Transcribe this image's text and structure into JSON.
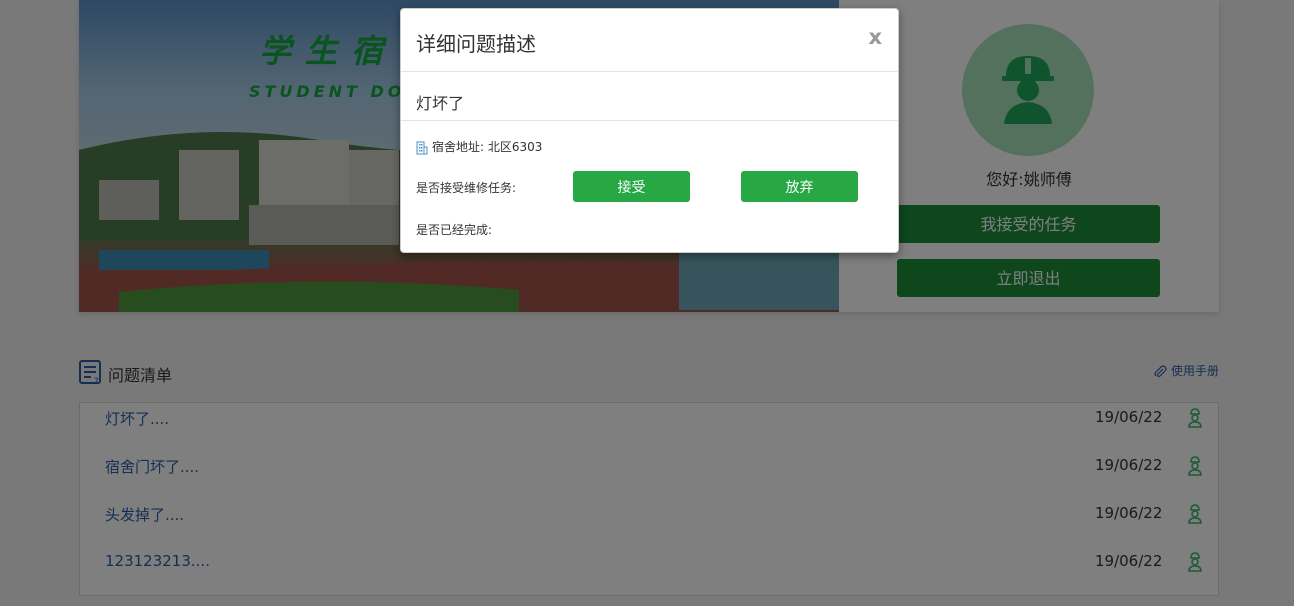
{
  "banner": {
    "title": "学生宿舍",
    "subtitle": "STUDENT DORMITORY"
  },
  "profile": {
    "greeting": "您好:姚师傅",
    "tasks_button": "我接受的任务",
    "exit_button": "立即退出"
  },
  "list": {
    "title": "问题清单",
    "manual_link": "使用手册",
    "rows": [
      {
        "title": "灯坏了....",
        "date": "19/06/22"
      },
      {
        "title": "宿舍门坏了....",
        "date": "19/06/22"
      },
      {
        "title": "头发掉了....",
        "date": "19/06/22"
      },
      {
        "title": "123123213....",
        "date": "19/06/22"
      }
    ]
  },
  "modal": {
    "title": "详细问题描述",
    "close": "x",
    "problem": "灯坏了",
    "address": "宿舍地址: 北区6303",
    "accept_label": "是否接受维修任务:",
    "accept_button": "接受",
    "abandon_button": "放弃",
    "done_label": "是否已经完成:"
  },
  "colors": {
    "primary_green": "#28a745",
    "dark_green": "#1f8f3a",
    "link_blue": "#2a5ca8",
    "avatar_bg": "#a8e3bd"
  },
  "icons": {
    "list": "checklist-icon",
    "manual": "paperclip-icon",
    "row": "worker-icon",
    "address": "building-icon",
    "avatar": "worker-helmet-icon"
  }
}
